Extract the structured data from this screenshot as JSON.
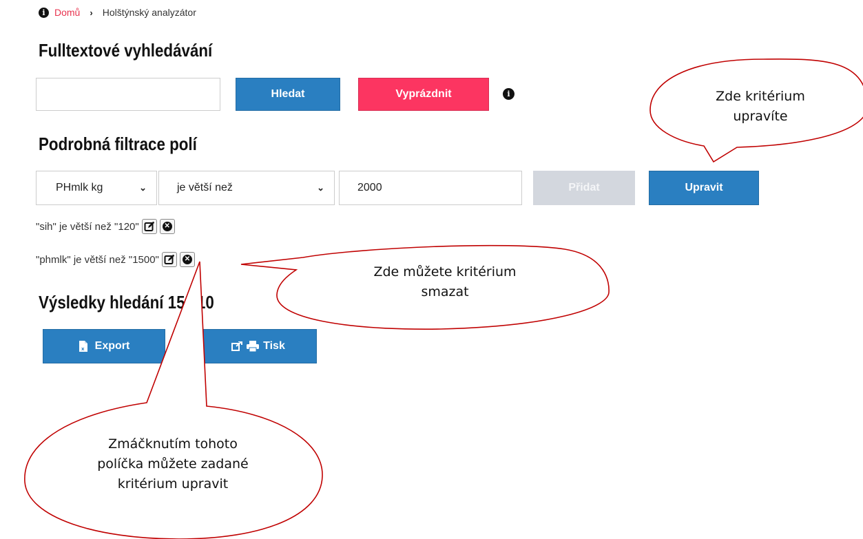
{
  "breadcrumb": {
    "home": "Domů",
    "current": "Holštýnský analyzátor"
  },
  "fulltext": {
    "title": "Fulltextové vyhledávání",
    "search_value": "",
    "search_button": "Hledat",
    "clear_button": "Vyprázdnit"
  },
  "filter": {
    "title": "Podrobná filtrace polí",
    "field_select": "PHmlk kg",
    "operator_select": "je větší než",
    "value": "2000",
    "add_button": "Přidat",
    "edit_button": "Upravit"
  },
  "criteria": [
    {
      "text": "\"sih\" je větší než \"120\""
    },
    {
      "text": "\"phmlk\" je větší než \"1500\""
    }
  ],
  "results": {
    "title": "Výsledky hledání 15/110",
    "export_button": "Export",
    "print_button": "Tisk"
  },
  "callouts": {
    "edit_tip_line1": "Zde kritérium",
    "edit_tip_line2": "upravíte",
    "delete_tip_line1": "Zde můžete kritérium",
    "delete_tip_line2": "smazat",
    "pencil_tip_line1": "Zmáčknutím tohoto",
    "pencil_tip_line2": "políčka můžete zadané",
    "pencil_tip_line3": "kritérium upravit"
  },
  "colors": {
    "primary": "#2a7fc1",
    "danger": "#fc3561",
    "disabled": "#d3d7de",
    "callout_border": "#c00000"
  }
}
